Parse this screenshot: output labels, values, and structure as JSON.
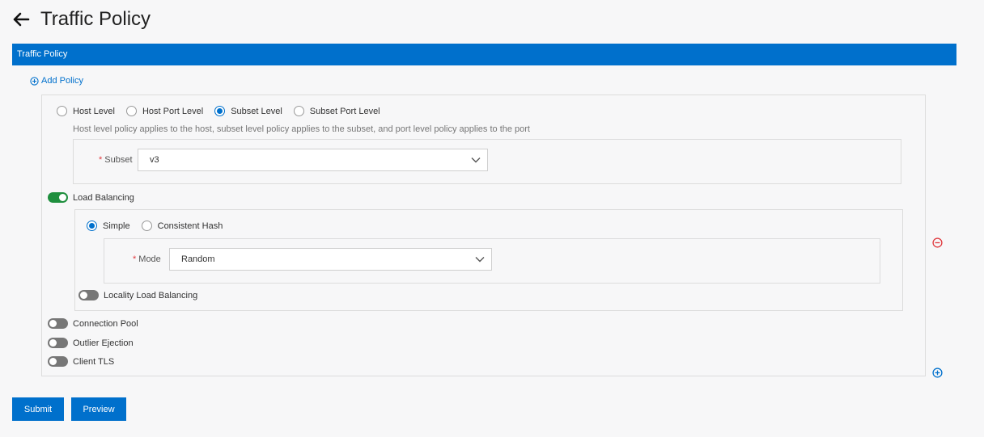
{
  "page": {
    "title": "Traffic Policy"
  },
  "section": {
    "title": "Traffic Policy"
  },
  "add_policy": {
    "label": "Add Policy"
  },
  "level": {
    "options": [
      {
        "label": "Host Level",
        "checked": false
      },
      {
        "label": "Host Port Level",
        "checked": false
      },
      {
        "label": "Subset Level",
        "checked": true
      },
      {
        "label": "Subset Port Level",
        "checked": false
      }
    ],
    "hint": "Host level policy applies to the host, subset level policy applies to the subset, and port level policy applies to the port"
  },
  "subset": {
    "label": "Subset",
    "required_mark": "*",
    "value": "v3"
  },
  "load_balancing": {
    "label": "Load Balancing",
    "enabled": true,
    "type_options": [
      {
        "label": "Simple",
        "checked": true
      },
      {
        "label": "Consistent Hash",
        "checked": false
      }
    ],
    "mode": {
      "label": "Mode",
      "required_mark": "*",
      "value": "Random"
    },
    "locality": {
      "label": "Locality Load Balancing",
      "enabled": false
    }
  },
  "toggles": {
    "connection_pool": {
      "label": "Connection Pool",
      "enabled": false
    },
    "outlier_ejection": {
      "label": "Outlier Ejection",
      "enabled": false
    },
    "client_tls": {
      "label": "Client TLS",
      "enabled": false
    }
  },
  "buttons": {
    "submit": "Submit",
    "preview": "Preview"
  },
  "colors": {
    "accent": "#0070cc",
    "toggle_on": "#1f8f3e",
    "toggle_off": "#777777",
    "danger": "#e0393e"
  }
}
